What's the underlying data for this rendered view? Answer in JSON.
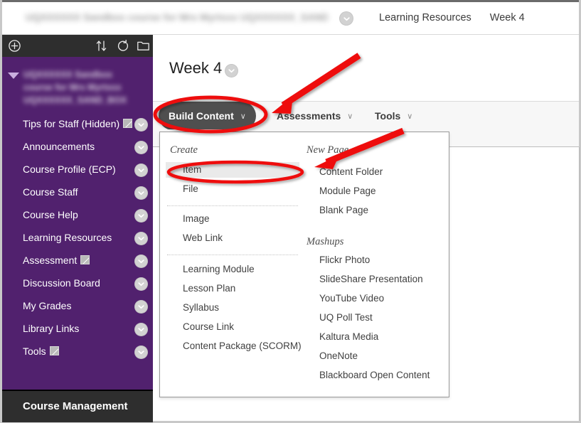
{
  "global_header": {
    "course_title_redacted": "UQXXXXXX Sandbox course for Mrs Myrtxxx UQXXXXXX_SAND_BOX",
    "course_menu_chevron_icon": "chevron-down-circle-icon",
    "breadcrumbs": [
      "Learning Resources",
      "Week 4"
    ]
  },
  "course_menu": {
    "toolbar_icons": [
      "plus-circle-icon",
      "sort-arrows-icon",
      "refresh-icon",
      "folder-icon"
    ],
    "course_title_redacted": "UQXXXXXX Sandbox course for Mrs Myrtxxx UQXXXXXX_SAND_BOX",
    "items": [
      {
        "label": "Tips for Staff (Hidden)",
        "external": true
      },
      {
        "label": "Announcements",
        "external": false
      },
      {
        "label": "Course Profile (ECP)",
        "external": false
      },
      {
        "label": "Course Staff",
        "external": false
      },
      {
        "label": "Course Help",
        "external": false
      },
      {
        "label": "Learning Resources",
        "external": false
      },
      {
        "label": "Assessment",
        "external": true
      },
      {
        "label": "Discussion Board",
        "external": false
      },
      {
        "label": "My Grades",
        "external": false
      },
      {
        "label": "Library Links",
        "external": false
      },
      {
        "label": "Tools",
        "external": true
      }
    ],
    "bottom_section_label": "Course Management"
  },
  "content": {
    "page_title": "Week 4",
    "page_title_chevron_icon": "chevron-down-circle-icon",
    "action_bar": [
      {
        "label": "Build Content",
        "caret": "∨",
        "active": true
      },
      {
        "label": "Assessments",
        "caret": "∨",
        "active": false
      },
      {
        "label": "Tools",
        "caret": "∨",
        "active": false
      }
    ]
  },
  "dropdown": {
    "left_column": {
      "heading": "Create",
      "groups": [
        [
          "Item",
          "File"
        ],
        [
          "Image",
          "Web Link"
        ],
        [
          "Learning Module",
          "Lesson Plan",
          "Syllabus",
          "Course Link",
          "Content Package (SCORM)"
        ]
      ],
      "highlighted_item": "Item"
    },
    "right_column": {
      "heading_1": "New Page",
      "group_1": [
        "Content Folder",
        "Module Page",
        "Blank Page"
      ],
      "heading_2": "Mashups",
      "group_2": [
        "Flickr Photo",
        "SlideShare Presentation",
        "YouTube Video",
        "UQ Poll Test",
        "Kaltura Media",
        "OneNote",
        "Blackboard Open Content"
      ]
    }
  },
  "annotations": {
    "color": "#ee1111",
    "ellipse_build_content": "Build Content",
    "ellipse_item": "Item",
    "arrow_1_target": "Build Content",
    "arrow_2_target": "Item"
  },
  "colors": {
    "sidebar_purple": "#51216e",
    "toolbar_dark": "#2e2e2e",
    "button_dark": "#4f4f4f",
    "annotation_red": "#ee1111",
    "highlight_grey": "#eaeaea"
  }
}
